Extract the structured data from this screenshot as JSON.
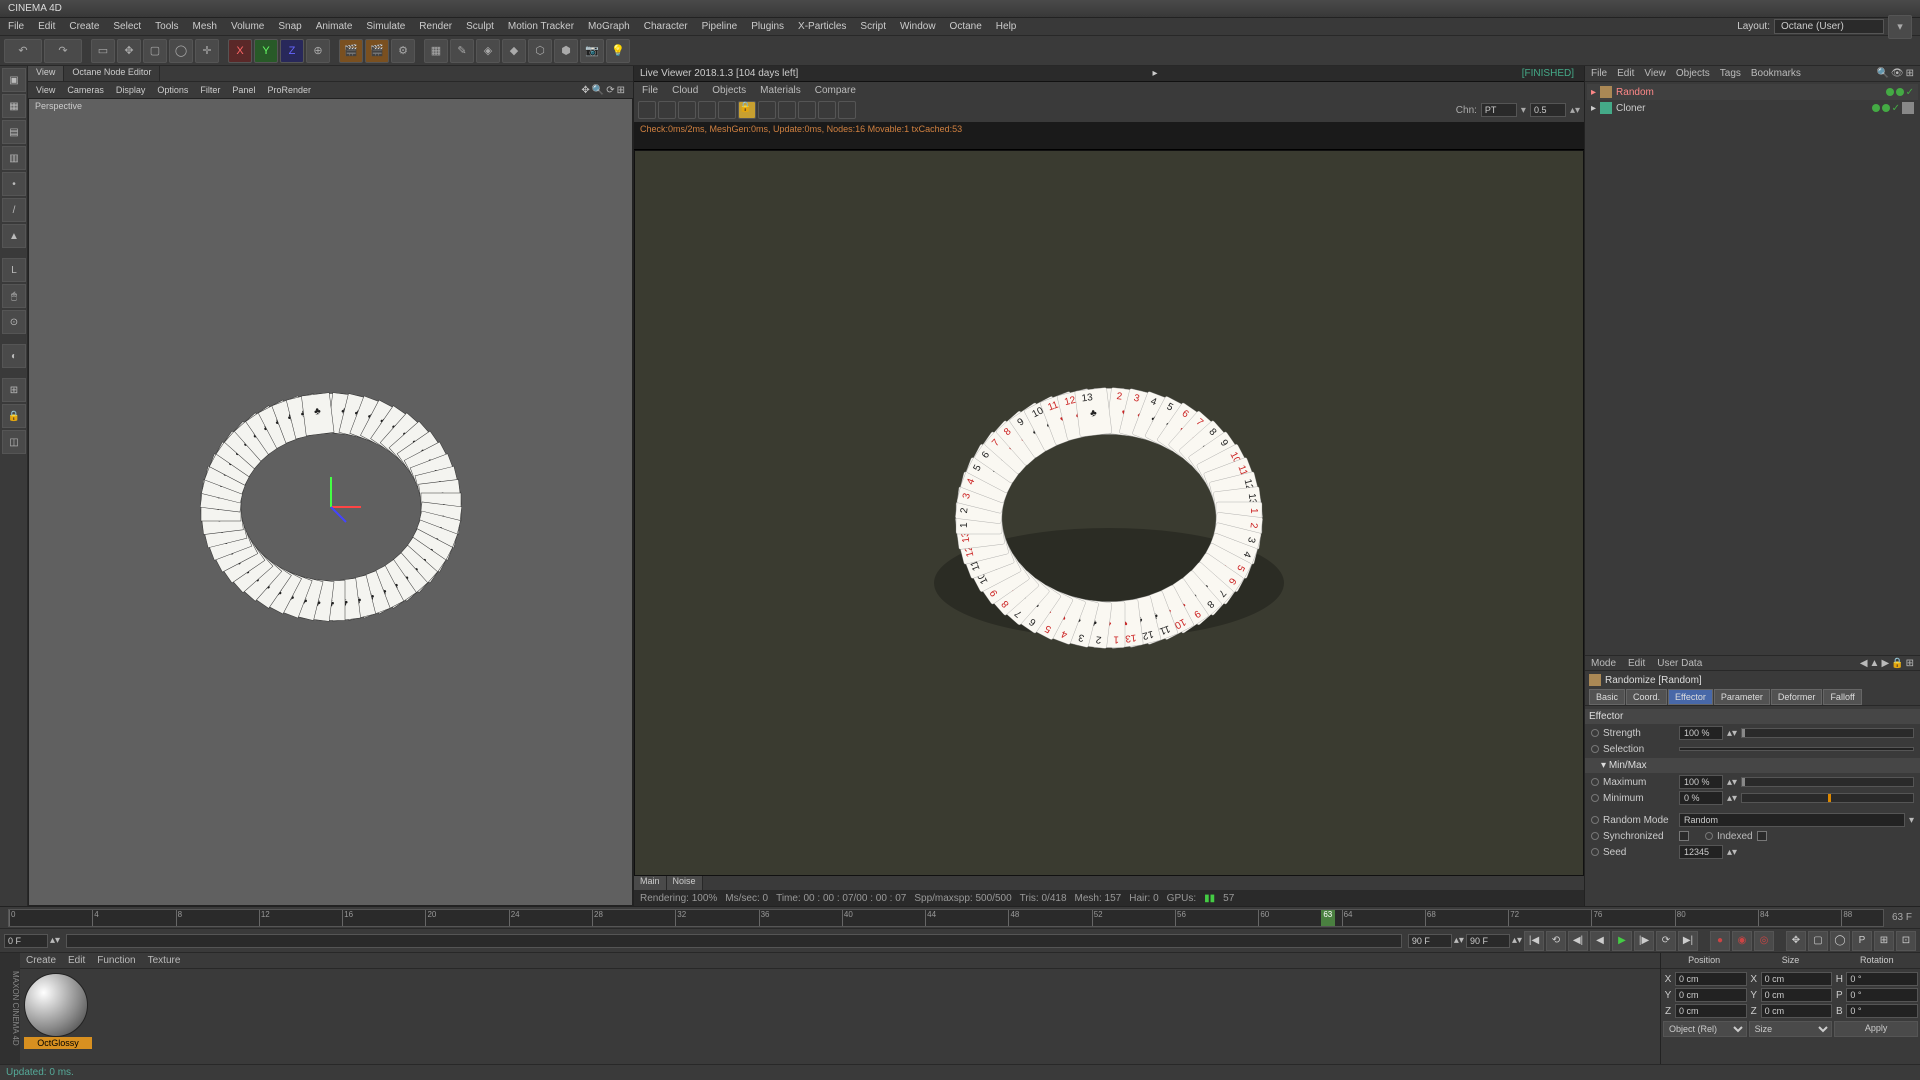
{
  "app": {
    "title": "CINEMA 4D"
  },
  "menubar": [
    "File",
    "Edit",
    "Create",
    "Select",
    "Tools",
    "Mesh",
    "Volume",
    "Snap",
    "Animate",
    "Simulate",
    "Render",
    "Sculpt",
    "Motion Tracker",
    "MoGraph",
    "Character",
    "Pipeline",
    "Plugins",
    "X-Particles",
    "Script",
    "Window",
    "Octane",
    "Help"
  ],
  "layout": {
    "label": "Layout:",
    "value": "Octane (User)"
  },
  "viewport": {
    "tabs": [
      "View",
      "Octane Node Editor"
    ],
    "menu": [
      "View",
      "Cameras",
      "Display",
      "Options",
      "Filter",
      "Panel",
      "ProRender"
    ],
    "label": "Perspective"
  },
  "liveviewer": {
    "title": "Live Viewer 2018.1.3 [104 days left]",
    "status": "[FINISHED]",
    "menu": [
      "File",
      "Cloud",
      "Objects",
      "Materials",
      "Compare"
    ],
    "chn_label": "Chn:",
    "chn_mode": "PT",
    "chn_val": "0.5",
    "stats": "Check:0ms/2ms, MeshGen:0ms, Update:0ms, Nodes:16 Movable:1 txCached:53",
    "tabs_bottom": [
      "Main",
      "Noise"
    ],
    "render_status": {
      "rendering": "Rendering: 100%",
      "mssec": "Ms/sec: 0",
      "time": "Time: 00 : 00 : 07/00 : 00 : 07",
      "spp": "Spp/maxspp: 500/500",
      "tris": "Tris: 0/418",
      "mesh": "Mesh: 157",
      "hair": "Hair: 0",
      "gpu": "GPUs:",
      "last": "57"
    }
  },
  "objmgr": {
    "menu": [
      "File",
      "Edit",
      "View",
      "Objects",
      "Tags",
      "Bookmarks"
    ],
    "items": [
      {
        "name": "Random",
        "sel": true,
        "indent": 0
      },
      {
        "name": "Cloner",
        "sel": false,
        "indent": 0
      }
    ]
  },
  "attrmgr": {
    "menu": [
      "Mode",
      "Edit",
      "User Data"
    ],
    "object": "Randomize [Random]",
    "tabs": [
      "Basic",
      "Coord.",
      "Effector",
      "Parameter",
      "Deformer",
      "Falloff"
    ],
    "active_tab": 2,
    "section_effector": "Effector",
    "section_minmax": "Min/Max",
    "strength_label": "Strength",
    "strength_val": "100 %",
    "selection_label": "Selection",
    "maximum_label": "Maximum",
    "maximum_val": "100 %",
    "minimum_label": "Minimum",
    "minimum_val": "0 %",
    "randommode_label": "Random Mode",
    "randommode_val": "Random",
    "sync_label": "Synchronized",
    "indexed_label": "Indexed",
    "seed_label": "Seed",
    "seed_val": "12345"
  },
  "timeline": {
    "start": "0 F",
    "end": "90 F",
    "range_start": "0 F",
    "range_end": "90 F",
    "current_label": "63 F",
    "current": 63,
    "ticks": [
      0,
      4,
      8,
      12,
      16,
      20,
      24,
      28,
      32,
      36,
      40,
      44,
      48,
      52,
      56,
      60,
      64,
      68,
      72,
      76,
      80,
      84,
      88
    ]
  },
  "matmgr": {
    "menu": [
      "Create",
      "Edit",
      "Function",
      "Texture"
    ],
    "thumb_name": "OctGlossy"
  },
  "coords": {
    "headers": [
      "Position",
      "Size",
      "Rotation"
    ],
    "rows": [
      {
        "axis": "X",
        "p": "0 cm",
        "s": "0 cm",
        "rlabel": "H",
        "r": "0 °"
      },
      {
        "axis": "Y",
        "p": "0 cm",
        "s": "0 cm",
        "rlabel": "P",
        "r": "0 °"
      },
      {
        "axis": "Z",
        "p": "0 cm",
        "s": "0 cm",
        "rlabel": "B",
        "r": "0 °"
      }
    ],
    "mode1": "Object (Rel)",
    "mode2": "Size",
    "apply": "Apply"
  },
  "status": "Updated: 0 ms."
}
